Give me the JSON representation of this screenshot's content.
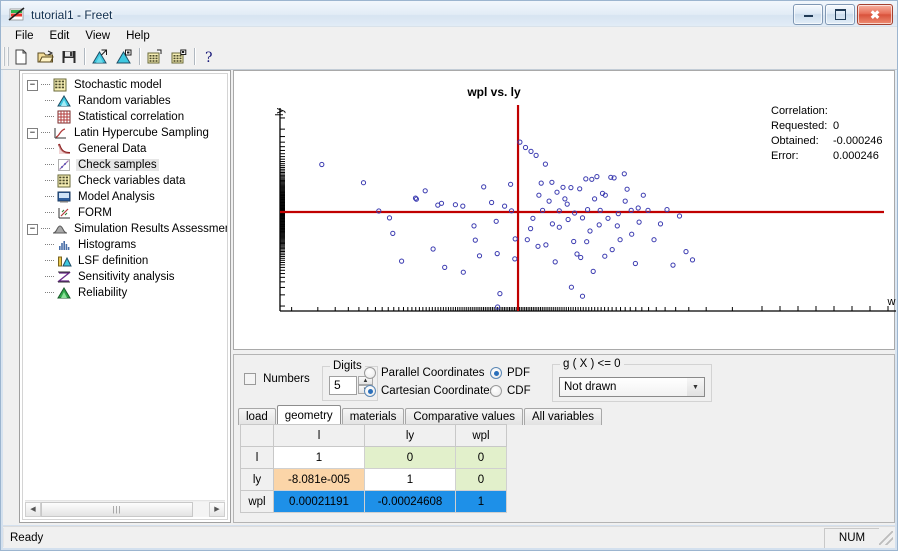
{
  "window": {
    "title": "tutorial1 - Freet",
    "icon": "app-icon",
    "controls": {
      "minimize": "minimize",
      "maximize": "maximize",
      "close": "close"
    }
  },
  "menu": {
    "items": [
      "File",
      "Edit",
      "View",
      "Help"
    ]
  },
  "toolbar": {
    "buttons": [
      {
        "name": "new-icon",
        "tip": "New"
      },
      {
        "name": "open-icon",
        "tip": "Open"
      },
      {
        "name": "save-icon",
        "tip": "Save"
      },
      {
        "name": "random-variables-icon",
        "tip": "Random variables"
      },
      {
        "name": "random-variables-alt-icon",
        "tip": "Random variables 2"
      },
      {
        "name": "data-grid-icon",
        "tip": "Data grid"
      },
      {
        "name": "data-grid-alt-icon",
        "tip": "Data grid 2"
      },
      {
        "name": "help-icon",
        "tip": "Help"
      }
    ]
  },
  "tree": {
    "nodes": [
      {
        "label": "Stochastic model",
        "level": 0,
        "icon": "grid-yellow-icon",
        "expander": "-",
        "selected": false
      },
      {
        "label": "Random variables",
        "level": 1,
        "icon": "distribution-icon",
        "expander": "",
        "selected": false
      },
      {
        "label": "Statistical correlation",
        "level": 1,
        "icon": "correlation-grid-icon",
        "expander": "",
        "selected": false
      },
      {
        "label": "Latin Hypercube Sampling",
        "level": 0,
        "icon": "lhs-icon",
        "expander": "-",
        "selected": false
      },
      {
        "label": "General Data",
        "level": 1,
        "icon": "curve-icon",
        "expander": "",
        "selected": false
      },
      {
        "label": "Check samples",
        "level": 1,
        "icon": "check-samples-icon",
        "expander": "",
        "selected": true
      },
      {
        "label": "Check variables data",
        "level": 1,
        "icon": "grid-yellow-icon",
        "expander": "",
        "selected": false
      },
      {
        "label": "Model Analysis",
        "level": 1,
        "icon": "model-analysis-icon",
        "expander": "",
        "selected": false
      },
      {
        "label": "FORM",
        "level": 1,
        "icon": "form-icon",
        "expander": "",
        "selected": false
      },
      {
        "label": "Simulation Results Assessment",
        "level": 0,
        "icon": "hill-gray-icon",
        "expander": "-",
        "selected": false
      },
      {
        "label": "Histograms",
        "level": 1,
        "icon": "histogram-icon",
        "expander": "",
        "selected": false
      },
      {
        "label": "LSF definition",
        "level": 1,
        "icon": "lsf-icon",
        "expander": "",
        "selected": false
      },
      {
        "label": "Sensitivity analysis",
        "level": 1,
        "icon": "sensitivity-icon",
        "expander": "",
        "selected": false
      },
      {
        "label": "Reliability",
        "level": 1,
        "icon": "reliability-icon",
        "expander": "",
        "selected": false
      }
    ],
    "scrollbar": {
      "left_arrow": "◄",
      "right_arrow": "►",
      "thumb": "|||"
    }
  },
  "chart_data": {
    "type": "scatter",
    "title": "wpl vs. ly",
    "xlabel": "wpl",
    "ylabel": "ly",
    "grid": false,
    "legend": null,
    "marker": {
      "shape": "circle-open",
      "color": "#3a3ab0",
      "size": 4
    },
    "crosshair": {
      "color": "#c00000",
      "x": 0.513,
      "y": 0.5
    },
    "xlim": [
      0,
      1
    ],
    "ylim": [
      0,
      1
    ],
    "points": [
      [
        0.09,
        0.74
      ],
      [
        0.18,
        0.648
      ],
      [
        0.213,
        0.505
      ],
      [
        0.292,
        0.57
      ],
      [
        0.262,
        0.252
      ],
      [
        0.313,
        0.607
      ],
      [
        0.33,
        0.313
      ],
      [
        0.348,
        0.544
      ],
      [
        0.378,
        0.537
      ],
      [
        0.394,
        0.53
      ],
      [
        0.355,
        0.22
      ],
      [
        0.418,
        0.43
      ],
      [
        0.421,
        0.358
      ],
      [
        0.439,
        0.627
      ],
      [
        0.43,
        0.279
      ],
      [
        0.456,
        0.548
      ],
      [
        0.466,
        0.453
      ],
      [
        0.474,
        0.088
      ],
      [
        0.484,
        0.53
      ],
      [
        0.497,
        0.64
      ],
      [
        0.499,
        0.506
      ],
      [
        0.507,
        0.364
      ],
      [
        0.517,
        0.853
      ],
      [
        0.529,
        0.826
      ],
      [
        0.541,
        0.806
      ],
      [
        0.552,
        0.786
      ],
      [
        0.54,
        0.416
      ],
      [
        0.556,
        0.327
      ],
      [
        0.563,
        0.646
      ],
      [
        0.566,
        0.508
      ],
      [
        0.572,
        0.742
      ],
      [
        0.58,
        0.555
      ],
      [
        0.587,
        0.44
      ],
      [
        0.593,
        0.248
      ],
      [
        0.597,
        0.6
      ],
      [
        0.602,
        0.506
      ],
      [
        0.61,
        0.625
      ],
      [
        0.614,
        0.566
      ],
      [
        0.621,
        0.462
      ],
      [
        0.627,
        0.623
      ],
      [
        0.633,
        0.351
      ],
      [
        0.64,
        0.288
      ],
      [
        0.646,
        0.617
      ],
      [
        0.652,
        0.47
      ],
      [
        0.659,
        0.667
      ],
      [
        0.663,
        0.512
      ],
      [
        0.668,
        0.404
      ],
      [
        0.672,
        0.665
      ],
      [
        0.678,
        0.566
      ],
      [
        0.683,
        0.679
      ],
      [
        0.69,
        0.508
      ],
      [
        0.695,
        0.594
      ],
      [
        0.7,
        0.277
      ],
      [
        0.707,
        0.468
      ],
      [
        0.713,
        0.675
      ],
      [
        0.72,
        0.672
      ],
      [
        0.727,
        0.43
      ],
      [
        0.733,
        0.36
      ],
      [
        0.742,
        0.693
      ],
      [
        0.748,
        0.615
      ],
      [
        0.757,
        0.508
      ],
      [
        0.766,
        0.24
      ],
      [
        0.774,
        0.449
      ],
      [
        0.783,
        0.585
      ],
      [
        0.793,
        0.508
      ],
      [
        0.806,
        0.36
      ],
      [
        0.82,
        0.44
      ],
      [
        0.834,
        0.512
      ],
      [
        0.847,
        0.232
      ],
      [
        0.861,
        0.48
      ],
      [
        0.875,
        0.3
      ],
      [
        0.889,
        0.258
      ],
      [
        0.243,
        0.392
      ],
      [
        0.395,
        0.196
      ],
      [
        0.468,
        0.29
      ],
      [
        0.34,
        0.535
      ],
      [
        0.506,
        0.263
      ],
      [
        0.533,
        0.36
      ],
      [
        0.545,
        0.468
      ],
      [
        0.558,
        0.585
      ],
      [
        0.573,
        0.334
      ],
      [
        0.586,
        0.65
      ],
      [
        0.602,
        0.423
      ],
      [
        0.619,
        0.54
      ],
      [
        0.635,
        0.495
      ],
      [
        0.648,
        0.27
      ],
      [
        0.661,
        0.35
      ],
      [
        0.675,
        0.2
      ],
      [
        0.688,
        0.435
      ],
      [
        0.701,
        0.585
      ],
      [
        0.716,
        0.31
      ],
      [
        0.729,
        0.492
      ],
      [
        0.744,
        0.555
      ],
      [
        0.758,
        0.388
      ],
      [
        0.772,
        0.52
      ],
      [
        0.469,
        0.02
      ],
      [
        0.628,
        0.12
      ],
      [
        0.652,
        0.075
      ],
      [
        0.236,
        0.47
      ],
      [
        0.294,
        0.565
      ]
    ],
    "correlation": {
      "header": "Correlation:",
      "requested_label": "Requested:",
      "requested_value": "0",
      "obtained_label": "Obtained:",
      "obtained_value": "-0.000246",
      "error_label": "Error:",
      "error_value": "0.000246"
    }
  },
  "controls": {
    "numbers_checkbox": {
      "label": "Numbers",
      "checked": false
    },
    "digits": {
      "group_title": "Digits",
      "value": "5",
      "up": "▲",
      "down": "▼"
    },
    "coordinates": {
      "options": [
        "Parallel Coordinates",
        "Cartesian Coordinates"
      ],
      "selected": "Cartesian Coordinates"
    },
    "function_type": {
      "options": [
        "PDF",
        "CDF"
      ],
      "selected": "PDF"
    },
    "gx": {
      "group_title": "g ( X ) <= 0",
      "selected": "Not drawn",
      "arrow": "▼"
    }
  },
  "tabs": {
    "items": [
      "load",
      "geometry",
      "materials",
      "Comparative values",
      "All variables"
    ],
    "active": "geometry"
  },
  "table": {
    "columns": [
      "",
      "l",
      "ly",
      "wpl"
    ],
    "rows": [
      {
        "header": "l",
        "cells": [
          {
            "v": "1",
            "style": "white"
          },
          {
            "v": "0",
            "style": "green"
          },
          {
            "v": "0",
            "style": "green"
          }
        ]
      },
      {
        "header": "ly",
        "cells": [
          {
            "v": "-8.081e-005",
            "style": "orange"
          },
          {
            "v": "1",
            "style": "white"
          },
          {
            "v": "0",
            "style": "green"
          }
        ]
      },
      {
        "header": "wpl",
        "cells": [
          {
            "v": "0.00021191",
            "style": "blue"
          },
          {
            "v": "-0.00024608",
            "style": "blue"
          },
          {
            "v": "1",
            "style": "blue"
          }
        ]
      }
    ]
  },
  "statusbar": {
    "message": "Ready",
    "indicators": [
      "NUM"
    ]
  },
  "colors": {
    "accent_blue": "#1e90e8",
    "cell_green": "#e2f0cb",
    "cell_orange": "#fbd5a8",
    "crosshair_red": "#c00000",
    "marker_blue": "#3a3ab0"
  }
}
